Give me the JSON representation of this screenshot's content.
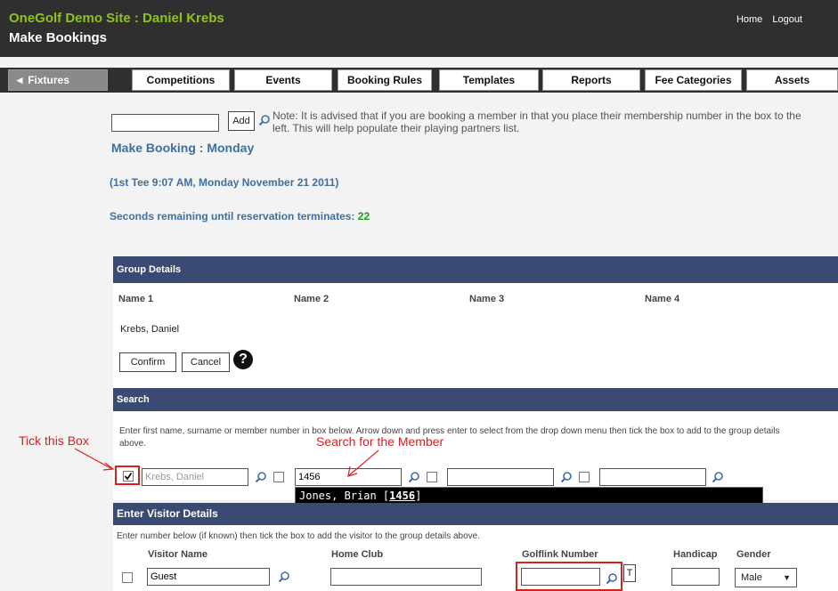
{
  "header": {
    "site_title": "OneGolf Demo Site : Daniel Krebs",
    "page_title": "Make Bookings",
    "links": [
      "Home",
      "Logout"
    ]
  },
  "nav": {
    "fixtures": "◄ Fixtures",
    "tabs": [
      "Competitions",
      "Events",
      "Booking Rules",
      "Templates",
      "Reports",
      "Fee Categories",
      "Assets"
    ]
  },
  "member_add": {
    "add_label": "Add",
    "note": "Note: It is advised that if you are booking a member in that you place their membership number in the box to the left. This will help populate their playing partners list."
  },
  "booking": {
    "title": "Make Booking : Monday",
    "tee_info": "(1st Tee 9:07 AM, Monday November 21 2011)",
    "timer_label": "Seconds remaining until reservation terminates:",
    "timer_value": "22"
  },
  "group_details": {
    "header": "Group Details",
    "columns": [
      "Name 1",
      "Name 2",
      "Name 3",
      "Name 4"
    ],
    "name1": "Krebs, Daniel",
    "confirm_label": "Confirm",
    "cancel_label": "Cancel",
    "help_glyph": "?"
  },
  "search": {
    "header": "Search",
    "instructions": "Enter first name, surname or member number in box below. Arrow down and press enter to select from the drop down menu then tick the box to add to the group details above.",
    "field1_value": "Krebs, Daniel",
    "field2_value": "1456",
    "dropdown_name": "Jones, Brian",
    "dropdown_number": "1456"
  },
  "annotations": {
    "tick": "Tick this Box",
    "search_member": "Search for the Member"
  },
  "visitor": {
    "header": "Enter Visitor Details",
    "instructions": "Enter number below (if known) then tick the box to add the visitor to the group details above.",
    "columns": [
      "Visitor Name",
      "Home Club",
      "Golflink Number",
      "Handicap",
      "Gender"
    ],
    "name_value": "Guest",
    "t_label": "T",
    "gender_value": "Male"
  },
  "colors": {
    "header_bg": "#2f2f2f",
    "site_title": "#8ec21f",
    "section_bar": "#3b4a73",
    "link_blue": "#3f6f9f",
    "annotation_red": "#d92020",
    "timer_green": "#1a9a1a"
  }
}
